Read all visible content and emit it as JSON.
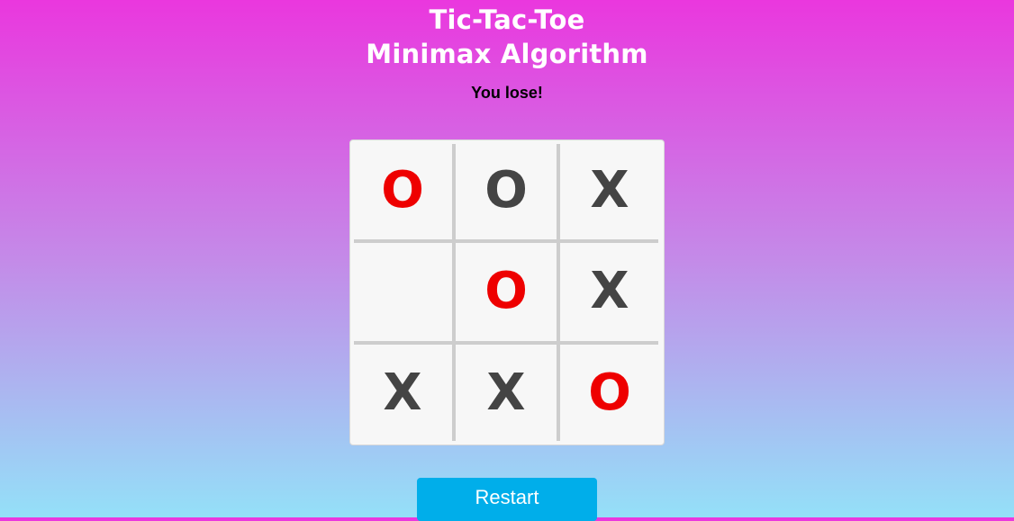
{
  "header": {
    "title_line1": "Tic-Tac-Toe",
    "title_line2": "Minimax Algorithm",
    "status": "You lose!"
  },
  "board": {
    "cells": [
      {
        "mark": "O",
        "color": "#ee0000"
      },
      {
        "mark": "O",
        "color": "#444444"
      },
      {
        "mark": "X",
        "color": "#444444"
      },
      {
        "mark": "",
        "color": "#444444"
      },
      {
        "mark": "O",
        "color": "#ee0000"
      },
      {
        "mark": "X",
        "color": "#444444"
      },
      {
        "mark": "X",
        "color": "#444444"
      },
      {
        "mark": "X",
        "color": "#444444"
      },
      {
        "mark": "O",
        "color": "#ee0000"
      }
    ]
  },
  "controls": {
    "restart_label": "Restart"
  },
  "colors": {
    "winning_mark": "#ee0000",
    "normal_mark": "#444444",
    "button": "#00aeea"
  }
}
